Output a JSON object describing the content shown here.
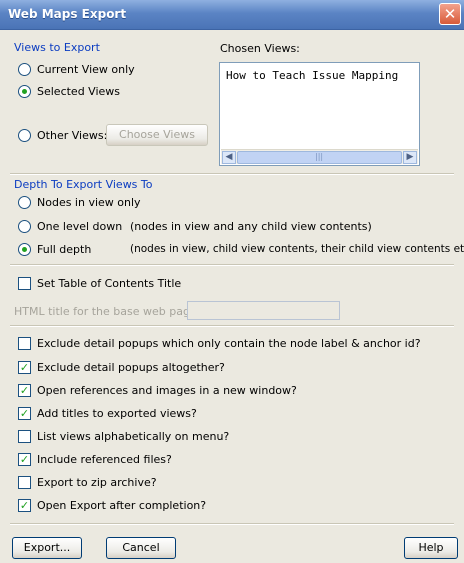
{
  "window": {
    "title": "Web Maps Export",
    "close_glyph": "✕"
  },
  "views_section": {
    "label": "Views to Export",
    "options": [
      {
        "label": "Current View only",
        "selected": false
      },
      {
        "label": "Selected Views",
        "selected": true
      },
      {
        "label": "Other Views:",
        "selected": false
      }
    ],
    "choose_views_button": "Choose Views"
  },
  "chosen_views": {
    "label": "Chosen Views:",
    "items": [
      "How to Teach Issue Mapping"
    ],
    "scroll_left": "◀",
    "scroll_right": "▶",
    "scroll_grip": "|||"
  },
  "depth_section": {
    "label": "Depth To Export Views To",
    "options": [
      {
        "label": "Nodes in view only",
        "hint": "",
        "selected": false
      },
      {
        "label": "One level down",
        "hint": "(nodes in view and any child view contents)",
        "selected": false
      },
      {
        "label": "Full depth",
        "hint": "(nodes in view, child view contents, their child view contents etc..)",
        "selected": true
      }
    ]
  },
  "toc": {
    "checkbox_label": "Set Table of Contents Title",
    "checked": false,
    "html_title_label": "HTML title for the base web page:",
    "html_title_value": ""
  },
  "options": [
    {
      "label": "Exclude detail popups which only contain the node label & anchor id?",
      "checked": false
    },
    {
      "label": "Exclude detail popups altogether?",
      "checked": true
    },
    {
      "label": "Open references and images in a new window?",
      "checked": true
    },
    {
      "label": "Add titles to exported views?",
      "checked": true
    },
    {
      "label": "List views alphabetically on menu?",
      "checked": false
    },
    {
      "label": "Include referenced files?",
      "checked": true
    },
    {
      "label": "Export to zip archive?",
      "checked": false
    },
    {
      "label": "Open Export after completion?",
      "checked": true
    }
  ],
  "buttons": {
    "export": "Export...",
    "cancel": "Cancel",
    "help": "Help"
  },
  "colors": {
    "section_label": "#0b3cc1",
    "check_mark": "#21a121",
    "titlebar": "#5b84c4"
  }
}
